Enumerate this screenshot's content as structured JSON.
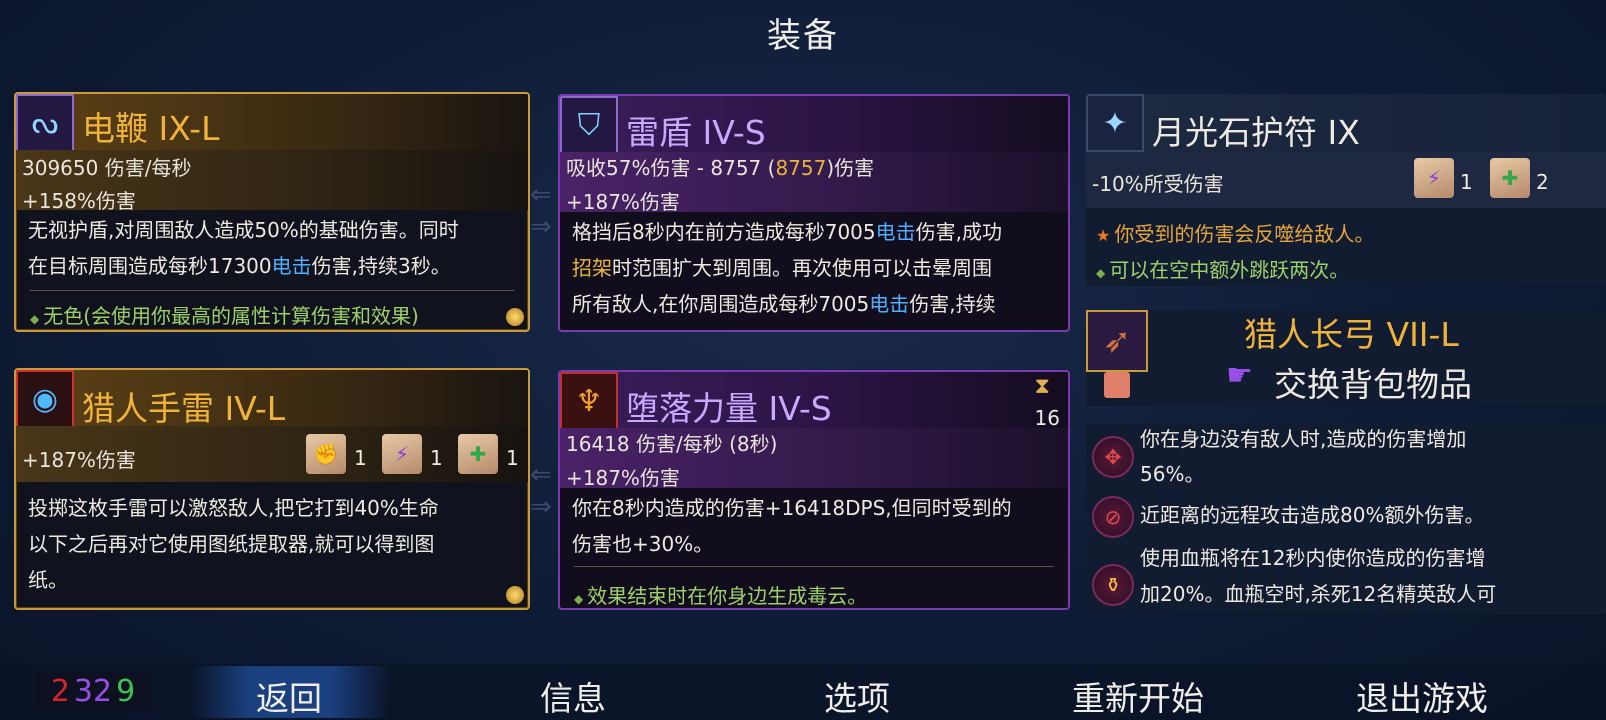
{
  "title": "装备",
  "weapon1": {
    "icon": "lightning-whip-icon",
    "name": "电鞭 IX-L",
    "dps": "309650 伤害/每秒",
    "bonus": "+158%伤害",
    "desc_1": "无视护盾,对周围敌人造成50%的基础伤害。同时",
    "desc_2a": "在目标周围造成每秒17300",
    "desc_2b": "电击",
    "desc_2c": "伤害,持续3秒。",
    "note": "无色(会使用你最高的属性计算伤害和效果)"
  },
  "shield": {
    "icon": "thunder-shield-icon",
    "name": "雷盾 IV-S",
    "stat_a": "吸收57%伤害 - 8757 (",
    "stat_b": "8757",
    "stat_c": ")伤害",
    "bonus": "+187%伤害",
    "d1a": "格挡后8秒内在前方造成每秒7005",
    "d1b": "电击",
    "d1c": "伤害,成功",
    "d2a": "招架",
    "d2b": "时范围扩大到周围。再次使用可以击晕周围",
    "d3a": "所有敌人,在你周围造成每秒7005",
    "d3b": "电击",
    "d3c": "伤害,持续"
  },
  "amulet": {
    "icon": "moonstone-amulet-icon",
    "name": "月光石护符 IX",
    "stat": "-10%所受伤害",
    "scroll1_count": "1",
    "scroll2_count": "2",
    "line1": "你受到的伤害会反噬给敌人。",
    "line2": "可以在空中额外跳跃两次。"
  },
  "grenade": {
    "icon": "hunter-grenade-icon",
    "name": "猎人手雷 IV-L",
    "bonus": "+187%伤害",
    "s1": "1",
    "s2": "1",
    "s3": "1",
    "desc_1": "投掷这枚手雷可以激怒敌人,把它打到40%生命",
    "desc_2": "以下之后再对它使用图纸提取器,就可以得到图",
    "desc_3": "纸。"
  },
  "power": {
    "icon": "fallen-power-icon",
    "name": "堕落力量 IV-S",
    "cooldown": "16",
    "dps": "16418 伤害/每秒 (8秒)",
    "bonus": "+187%伤害",
    "desc_1": "你在8秒内造成的伤害+16418DPS,但同时受到的",
    "desc_2": "伤害也+30%。",
    "note": "效果结束时在你身边生成毒云。"
  },
  "backpack": {
    "icon": "hunter-longbow-icon",
    "name": "猎人长弓 VII-L",
    "swap_label": "交换背包物品"
  },
  "mutations": [
    {
      "icon": "crosshair-mutation-icon",
      "text_1": "你在身边没有敌人时,造成的伤害增加",
      "text_2": "56%。"
    },
    {
      "icon": "close-range-mutation-icon",
      "text_1": "近距离的远程攻击造成80%额外伤害。"
    },
    {
      "icon": "flask-mutation-icon",
      "text_1": "使用血瓶将在12秒内使你造成的伤害增",
      "text_2": "加20%。血瓶空时,杀死12名精英敌人可"
    }
  ],
  "stats": {
    "brutality": "2",
    "tactics": "32",
    "survival": "9"
  },
  "menu": {
    "back": "返回",
    "info": "信息",
    "options": "选项",
    "restart": "重新开始",
    "quit": "退出游戏"
  },
  "colors": {
    "brutality": "#d8222a",
    "tactics": "#9a4ee8",
    "survival": "#3cc050",
    "gold_accent": "#f0b33a",
    "purple_accent": "#c9a8ff"
  }
}
